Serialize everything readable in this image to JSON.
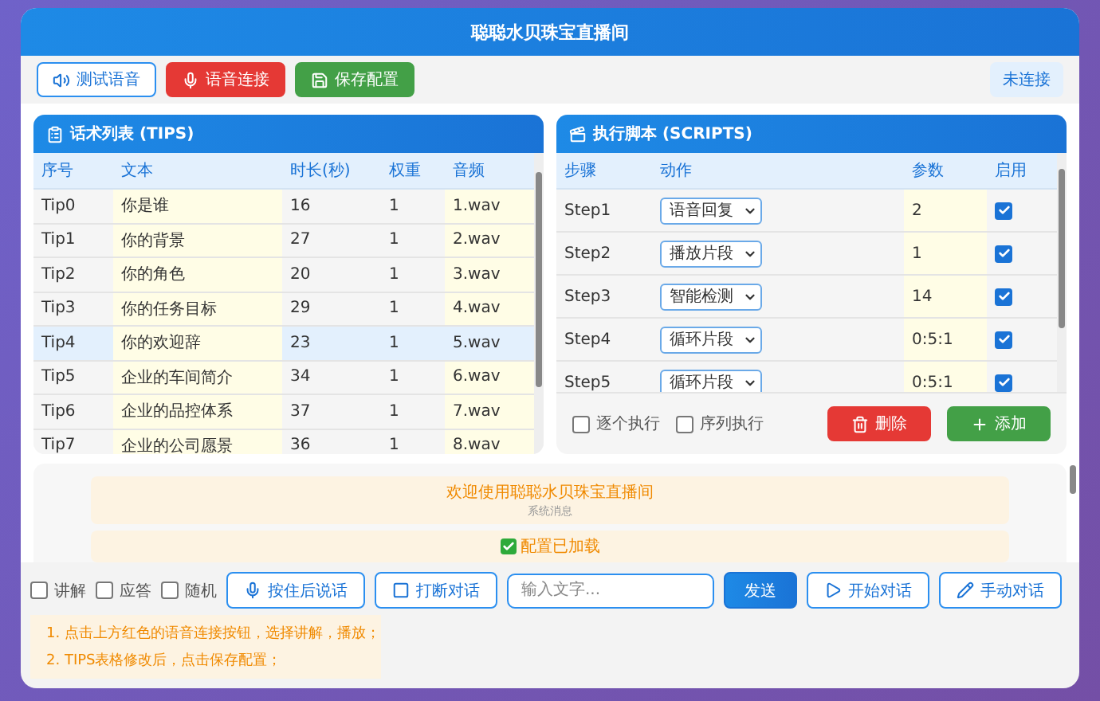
{
  "window": {
    "title": "聪聪水贝珠宝直播间"
  },
  "toolbar": {
    "buttons": [
      {
        "label": "测试语音",
        "kind": "outline"
      },
      {
        "label": "语音连接",
        "kind": "danger"
      },
      {
        "label": "保存配置",
        "kind": "success"
      }
    ],
    "status": "未连接"
  },
  "tips": {
    "title": "话术列表 (TIPS)",
    "columns": [
      "序号",
      "文本",
      "时长(秒)",
      "权重",
      "音频"
    ],
    "rows": [
      {
        "id": "Tip0",
        "text": "你是谁",
        "duration": "16",
        "weight": "1",
        "audio": "1.wav",
        "selected": false
      },
      {
        "id": "Tip1",
        "text": "你的背景",
        "duration": "27",
        "weight": "1",
        "audio": "2.wav",
        "selected": false
      },
      {
        "id": "Tip2",
        "text": "你的角色",
        "duration": "20",
        "weight": "1",
        "audio": "3.wav",
        "selected": false
      },
      {
        "id": "Tip3",
        "text": "你的任务目标",
        "duration": "29",
        "weight": "1",
        "audio": "4.wav",
        "selected": false
      },
      {
        "id": "Tip4",
        "text": "你的欢迎辞",
        "duration": "23",
        "weight": "1",
        "audio": "5.wav",
        "selected": true
      },
      {
        "id": "Tip5",
        "text": "企业的车间简介",
        "duration": "34",
        "weight": "1",
        "audio": "6.wav",
        "selected": false
      },
      {
        "id": "Tip6",
        "text": "企业的品控体系",
        "duration": "37",
        "weight": "1",
        "audio": "7.wav",
        "selected": false
      },
      {
        "id": "Tip7",
        "text": "企业的公司愿景",
        "duration": "36",
        "weight": "1",
        "audio": "8.wav",
        "selected": false
      }
    ]
  },
  "scripts": {
    "title": "执行脚本 (SCRIPTS)",
    "columns": [
      "步骤",
      "动作",
      "参数",
      "启用"
    ],
    "rows": [
      {
        "step": "Step1",
        "action": "语音回复",
        "param": "2",
        "enabled": true
      },
      {
        "step": "Step2",
        "action": "播放片段",
        "param": "1",
        "enabled": true
      },
      {
        "step": "Step3",
        "action": "智能检测",
        "param": "14",
        "enabled": true
      },
      {
        "step": "Step4",
        "action": "循环片段",
        "param": "0:5:1",
        "enabled": true
      },
      {
        "step": "Step5",
        "action": "循环片段",
        "param": "0:5:1",
        "enabled": true
      }
    ],
    "options": [
      {
        "label": "逐个执行",
        "checked": false
      },
      {
        "label": "序列执行",
        "checked": false
      }
    ],
    "buttons": [
      {
        "label": "删除",
        "kind": "danger"
      },
      {
        "label": "添加",
        "kind": "success"
      }
    ]
  },
  "messages": [
    {
      "kind": "system",
      "text": "欢迎使用聪聪水贝珠宝直播间",
      "sender": "系统消息"
    },
    {
      "kind": "success",
      "text": "配置已加载"
    }
  ],
  "controls": {
    "options": [
      {
        "label": "讲解",
        "checked": false
      },
      {
        "label": "应答",
        "checked": false
      },
      {
        "label": "随机",
        "checked": false
      }
    ],
    "buttons": [
      {
        "label": "按住后说话",
        "kind": "outline"
      },
      {
        "label": "打断对话",
        "kind": "outline"
      },
      {
        "label": "发送",
        "kind": "primary"
      },
      {
        "label": "开始对话",
        "kind": "outline"
      },
      {
        "label": "手动对话",
        "kind": "outline"
      }
    ],
    "input": {
      "placeholder": "输入文字..."
    }
  },
  "hints": [
    "1. 点击上方红色的语音连接按钮，选择讲解，播放；",
    "2. TIPS表格修改后，点击保存配置；"
  ]
}
